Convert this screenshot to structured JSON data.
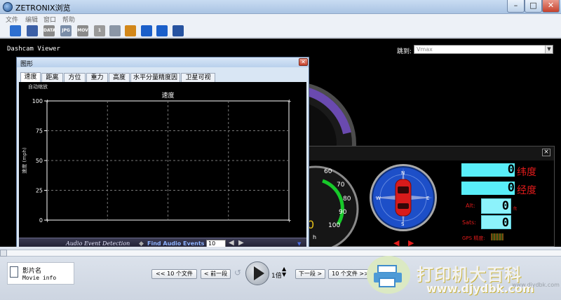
{
  "window": {
    "title": "ZETRONIX浏览"
  },
  "menu": [
    "文件",
    "编辑",
    "窗口",
    "帮助"
  ],
  "toolbar": [
    {
      "name": "open-folder-icon",
      "label": "",
      "color": "#2d6fd0"
    },
    {
      "name": "save-icon",
      "label": "",
      "color": "#3b5fa6"
    },
    {
      "name": "data-export-icon",
      "label": "DATA",
      "color": "#8a8a8a"
    },
    {
      "name": "jpg-export-icon",
      "label": "JPG",
      "color": "#7a8da8"
    },
    {
      "name": "mov-export-icon",
      "label": "MOV",
      "color": "#8a8a8a"
    },
    {
      "name": "one-view-icon",
      "label": "1",
      "color": "#9a9a9a"
    },
    {
      "name": "timeline-icon",
      "label": "",
      "color": "#8b96a6"
    },
    {
      "name": "map-icon",
      "label": "",
      "color": "#d2871a"
    },
    {
      "name": "fullscreen-icon",
      "label": "",
      "color": "#1b5fc9"
    },
    {
      "name": "split-icon",
      "label": "",
      "color": "#1b5fc9"
    },
    {
      "name": "settings-gear-icon",
      "label": "",
      "color": "#2753a0"
    }
  ],
  "viewer": {
    "label": "Dashcam Viewer",
    "jump_label": "跳到:",
    "jump_value": "Vmax"
  },
  "graph": {
    "title": "图形",
    "tabs": [
      "速度",
      "距离",
      "方位",
      "重力",
      "高度",
      "水平分量精度因子",
      "卫星可视"
    ],
    "active_tab": "速度",
    "autoscale_label": "自动缩放",
    "footer": {
      "audio_label": "Audio Event Detection",
      "find_label": "Find Audio Events",
      "count": "10"
    }
  },
  "chart_data": {
    "type": "line",
    "title": "速度",
    "xlabel": "",
    "ylabel": "速度 (mph)",
    "ylim": [
      0,
      100
    ],
    "yticks": [
      0,
      25,
      50,
      75,
      100
    ],
    "grid": true,
    "series": []
  },
  "dashboard": {
    "speedo_ticks": [
      "60",
      "70",
      "80",
      "90",
      "100"
    ],
    "speed_fragment": "0",
    "speed_unit": "h",
    "compass_labels": [
      "N",
      "E",
      "S",
      "W"
    ],
    "lat_label": "纬度",
    "lon_label": "经度",
    "lat_value": "0",
    "lon_value": "0",
    "alt_label": "Alt:",
    "alt_value": "0",
    "alt_unit": "ft",
    "sats_label": "Sats:",
    "sats_value": "0",
    "gps_label": "GPS 精度:"
  },
  "bottom": {
    "movie_name": "影片名",
    "movie_info": "Movie info",
    "prev10": "<< 10 个文件",
    "prev": "< 前一段",
    "speed": "1倍",
    "next": "下一段 >",
    "next10": "10 个文件 >>"
  },
  "watermark": {
    "brand": "打印机大百科",
    "url": "www.djydbk.com",
    "url_gray": "www.djydbk.com"
  }
}
